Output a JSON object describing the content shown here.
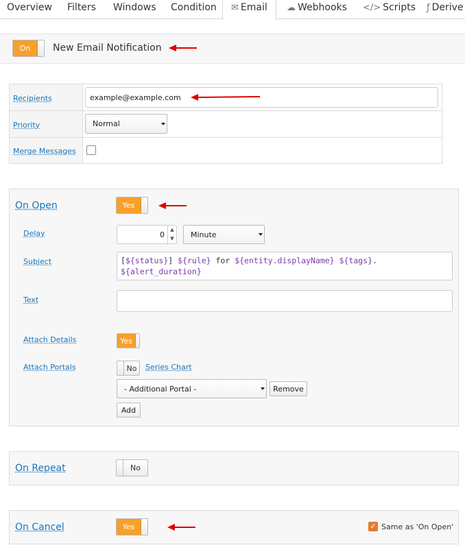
{
  "tabs": [
    {
      "label": "Overview",
      "icon": ""
    },
    {
      "label": "Filters",
      "icon": ""
    },
    {
      "label": "Windows",
      "icon": ""
    },
    {
      "label": "Condition",
      "icon": ""
    },
    {
      "label": "Email",
      "icon": "envelope-icon"
    },
    {
      "label": "Webhooks",
      "icon": "webhook-icon"
    },
    {
      "label": "Scripts",
      "icon": "code-icon"
    },
    {
      "label": "Derive",
      "icon": "function-icon"
    }
  ],
  "header": {
    "toggle_label": "On",
    "title": "New Email Notification"
  },
  "properties": {
    "recipients_label": "Recipients",
    "recipients_value": "example@example.com",
    "priority_label": "Priority",
    "priority_value": "Normal",
    "merge_label": "Merge Messages"
  },
  "on_open": {
    "title": "On Open",
    "toggle": "Yes",
    "delay_label": "Delay",
    "delay_value": "0",
    "delay_unit": "Minute",
    "subject_label": "Subject",
    "subject_parts": {
      "p1": "[",
      "v1": "${status}",
      "p2": "] ",
      "v2": "${rule}",
      "p3": " for ",
      "v3": "${entity.displayName}",
      "p4": " ",
      "v4": "${tags}",
      "p5": ".",
      "v5": "${alert_duration}"
    },
    "text_label": "Text",
    "attach_details_label": "Attach Details",
    "attach_details_toggle": "Yes",
    "attach_portals_label": "Attach Portals",
    "attach_portals_toggle": "No",
    "series_chart_link": "Series Chart",
    "portal_select": "- Additional Portal -",
    "remove_button": "Remove",
    "add_button": "Add"
  },
  "on_repeat": {
    "title": "On Repeat",
    "toggle": "No"
  },
  "on_cancel": {
    "title": "On Cancel",
    "toggle": "Yes",
    "same_as_label": "Same as 'On Open'"
  },
  "colors": {
    "accent": "#f7a02c",
    "link": "#1a75bb",
    "arrow": "#e00000"
  }
}
